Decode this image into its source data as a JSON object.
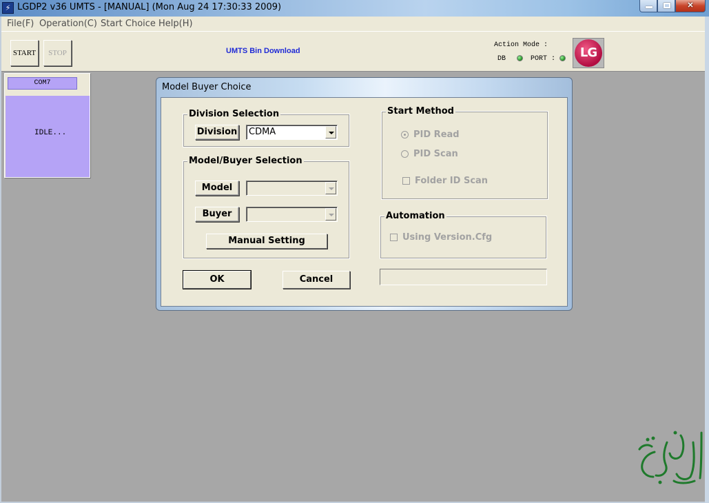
{
  "window": {
    "title": "LGDP2 v36 UMTS - [MANUAL] (Mon Aug 24 17:30:33 2009)",
    "icon": "app-icon"
  },
  "menu": [
    "File(F)",
    "Operation(C)",
    "Start Choice",
    "Help(H)"
  ],
  "toolbar": {
    "start_label": "START",
    "stop_label": "STOP",
    "title": "UMTS Bin Download",
    "action_mode_label": "Action Mode :",
    "db_label": "DB",
    "port_label": "PORT :",
    "logo_text": "LG",
    "led_color": "#1d8c1d"
  },
  "port_panel": {
    "port": "COM7",
    "status": "IDLE...",
    "color": "#b5a3f6"
  },
  "dialog": {
    "title": "Model Buyer Choice",
    "division_group": {
      "legend": "Division Selection",
      "division_label": "Division",
      "division_value": "CDMA"
    },
    "model_group": {
      "legend": "Model/Buyer Selection",
      "model_label": "Model",
      "model_value": "",
      "buyer_label": "Buyer",
      "buyer_value": "",
      "manual_setting_label": "Manual Setting"
    },
    "start_method": {
      "legend": "Start Method",
      "pid_read": "PID Read",
      "pid_read_selected": true,
      "pid_scan": "PID Scan",
      "folder_id_scan": "Folder ID Scan",
      "folder_id_scan_checked": false
    },
    "automation": {
      "legend": "Automation",
      "using_version": "Using Version.Cfg",
      "using_version_checked": false
    },
    "ok_label": "OK",
    "cancel_label": "Cancel",
    "status_text": ""
  },
  "watermark": {
    "icon": "arabic-calligraphy-watermark",
    "color": "#1f7a2c"
  }
}
